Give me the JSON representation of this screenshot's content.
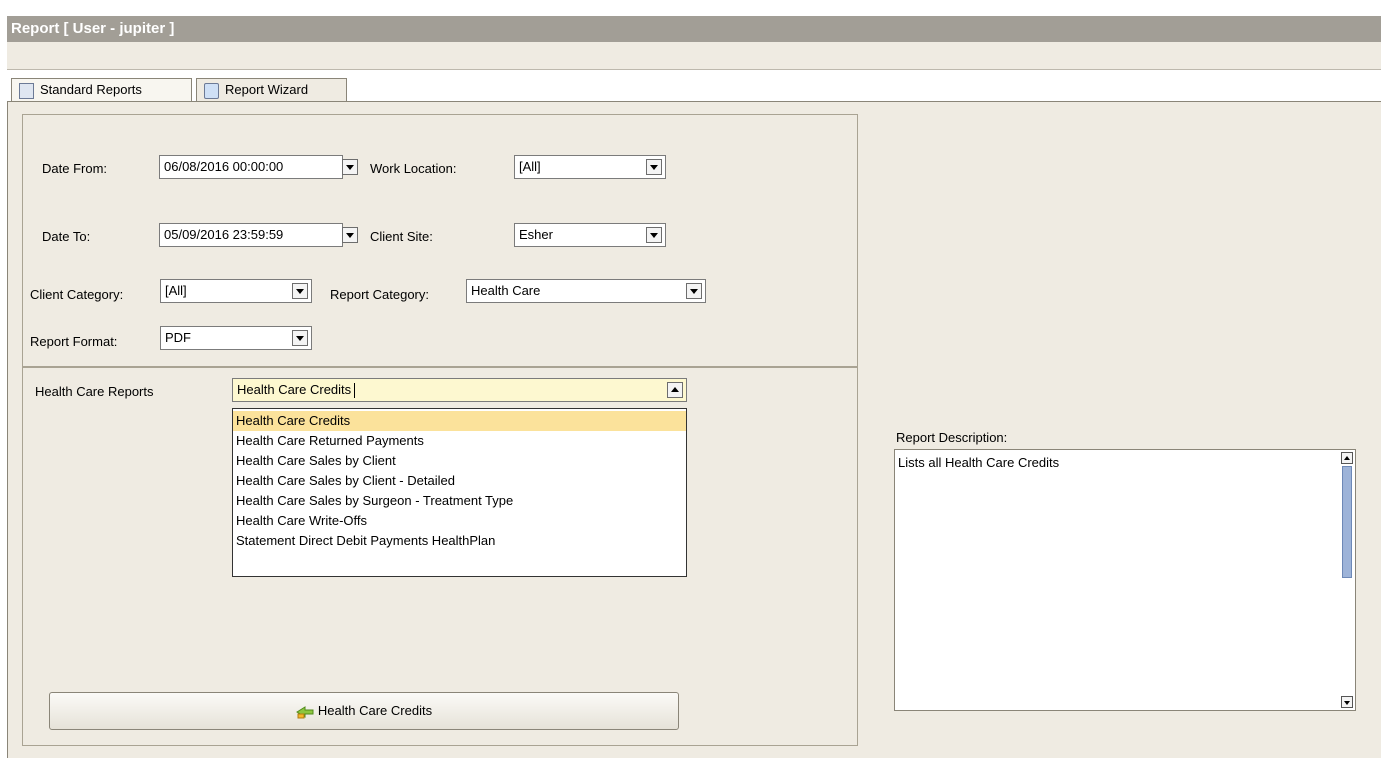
{
  "window": {
    "title": "Report  [ User - jupiter ]"
  },
  "tabs": [
    {
      "label": "Standard Reports",
      "icon": "report-list-icon",
      "active": true
    },
    {
      "label": "Report Wizard",
      "icon": "wizard-icon",
      "active": false
    }
  ],
  "filters": {
    "date_from": {
      "label": "Date From:",
      "value": "06/08/2016 00:00:00"
    },
    "date_to": {
      "label": "Date To:",
      "value": "05/09/2016 23:59:59"
    },
    "work_location": {
      "label": "Work Location:",
      "value": "[All]"
    },
    "client_site": {
      "label": "Client Site:",
      "value": "Esher"
    },
    "client_category": {
      "label": "Client Category:",
      "value": "[All]"
    },
    "report_category": {
      "label": "Report Category:",
      "value": "Health Care"
    },
    "report_format": {
      "label": "Report Format:",
      "value": "PDF"
    }
  },
  "reports": {
    "label": "Health Care Reports",
    "selected": "Health Care Credits",
    "options": [
      "Health Care Credits",
      "Health Care Returned Payments",
      "Health Care Sales by Client",
      "Health Care Sales by Client - Detailed",
      "Health Care Sales by Surgeon - Treatment Type",
      "Health Care Write-Offs",
      "Statement Direct Debit Payments HealthPlan"
    ]
  },
  "run_button": {
    "label": "Health Care Credits",
    "icon": "run-report-icon"
  },
  "description": {
    "label": "Report Description:",
    "text": "Lists all Health Care Credits"
  },
  "colors": {
    "title_bg": "#a29e96",
    "panel_bg": "#efebe2",
    "highlight": "#fbe29b",
    "combo_highlight": "#fdf8d0",
    "scrollbar_thumb": "#9db3d8"
  }
}
